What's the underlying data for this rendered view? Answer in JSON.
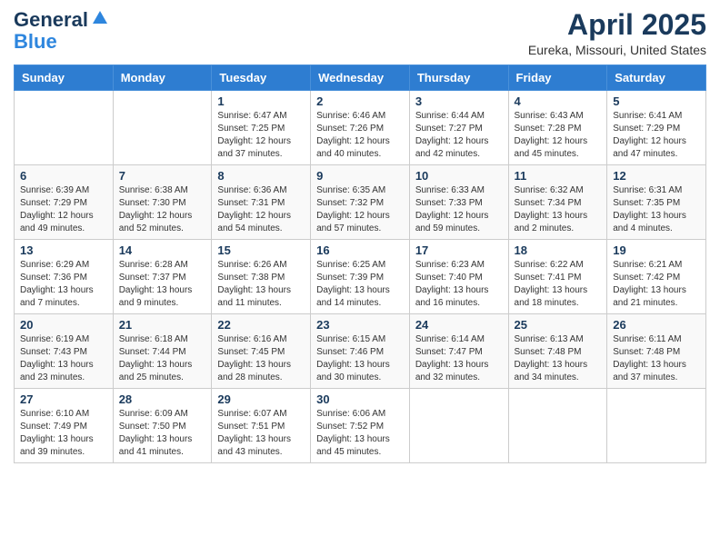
{
  "header": {
    "logo_line1": "General",
    "logo_line2": "Blue",
    "month_title": "April 2025",
    "location": "Eureka, Missouri, United States"
  },
  "days_of_week": [
    "Sunday",
    "Monday",
    "Tuesday",
    "Wednesday",
    "Thursday",
    "Friday",
    "Saturday"
  ],
  "weeks": [
    [
      {
        "day": "",
        "info": ""
      },
      {
        "day": "",
        "info": ""
      },
      {
        "day": "1",
        "info": "Sunrise: 6:47 AM\nSunset: 7:25 PM\nDaylight: 12 hours and 37 minutes."
      },
      {
        "day": "2",
        "info": "Sunrise: 6:46 AM\nSunset: 7:26 PM\nDaylight: 12 hours and 40 minutes."
      },
      {
        "day": "3",
        "info": "Sunrise: 6:44 AM\nSunset: 7:27 PM\nDaylight: 12 hours and 42 minutes."
      },
      {
        "day": "4",
        "info": "Sunrise: 6:43 AM\nSunset: 7:28 PM\nDaylight: 12 hours and 45 minutes."
      },
      {
        "day": "5",
        "info": "Sunrise: 6:41 AM\nSunset: 7:29 PM\nDaylight: 12 hours and 47 minutes."
      }
    ],
    [
      {
        "day": "6",
        "info": "Sunrise: 6:39 AM\nSunset: 7:29 PM\nDaylight: 12 hours and 49 minutes."
      },
      {
        "day": "7",
        "info": "Sunrise: 6:38 AM\nSunset: 7:30 PM\nDaylight: 12 hours and 52 minutes."
      },
      {
        "day": "8",
        "info": "Sunrise: 6:36 AM\nSunset: 7:31 PM\nDaylight: 12 hours and 54 minutes."
      },
      {
        "day": "9",
        "info": "Sunrise: 6:35 AM\nSunset: 7:32 PM\nDaylight: 12 hours and 57 minutes."
      },
      {
        "day": "10",
        "info": "Sunrise: 6:33 AM\nSunset: 7:33 PM\nDaylight: 12 hours and 59 minutes."
      },
      {
        "day": "11",
        "info": "Sunrise: 6:32 AM\nSunset: 7:34 PM\nDaylight: 13 hours and 2 minutes."
      },
      {
        "day": "12",
        "info": "Sunrise: 6:31 AM\nSunset: 7:35 PM\nDaylight: 13 hours and 4 minutes."
      }
    ],
    [
      {
        "day": "13",
        "info": "Sunrise: 6:29 AM\nSunset: 7:36 PM\nDaylight: 13 hours and 7 minutes."
      },
      {
        "day": "14",
        "info": "Sunrise: 6:28 AM\nSunset: 7:37 PM\nDaylight: 13 hours and 9 minutes."
      },
      {
        "day": "15",
        "info": "Sunrise: 6:26 AM\nSunset: 7:38 PM\nDaylight: 13 hours and 11 minutes."
      },
      {
        "day": "16",
        "info": "Sunrise: 6:25 AM\nSunset: 7:39 PM\nDaylight: 13 hours and 14 minutes."
      },
      {
        "day": "17",
        "info": "Sunrise: 6:23 AM\nSunset: 7:40 PM\nDaylight: 13 hours and 16 minutes."
      },
      {
        "day": "18",
        "info": "Sunrise: 6:22 AM\nSunset: 7:41 PM\nDaylight: 13 hours and 18 minutes."
      },
      {
        "day": "19",
        "info": "Sunrise: 6:21 AM\nSunset: 7:42 PM\nDaylight: 13 hours and 21 minutes."
      }
    ],
    [
      {
        "day": "20",
        "info": "Sunrise: 6:19 AM\nSunset: 7:43 PM\nDaylight: 13 hours and 23 minutes."
      },
      {
        "day": "21",
        "info": "Sunrise: 6:18 AM\nSunset: 7:44 PM\nDaylight: 13 hours and 25 minutes."
      },
      {
        "day": "22",
        "info": "Sunrise: 6:16 AM\nSunset: 7:45 PM\nDaylight: 13 hours and 28 minutes."
      },
      {
        "day": "23",
        "info": "Sunrise: 6:15 AM\nSunset: 7:46 PM\nDaylight: 13 hours and 30 minutes."
      },
      {
        "day": "24",
        "info": "Sunrise: 6:14 AM\nSunset: 7:47 PM\nDaylight: 13 hours and 32 minutes."
      },
      {
        "day": "25",
        "info": "Sunrise: 6:13 AM\nSunset: 7:48 PM\nDaylight: 13 hours and 34 minutes."
      },
      {
        "day": "26",
        "info": "Sunrise: 6:11 AM\nSunset: 7:48 PM\nDaylight: 13 hours and 37 minutes."
      }
    ],
    [
      {
        "day": "27",
        "info": "Sunrise: 6:10 AM\nSunset: 7:49 PM\nDaylight: 13 hours and 39 minutes."
      },
      {
        "day": "28",
        "info": "Sunrise: 6:09 AM\nSunset: 7:50 PM\nDaylight: 13 hours and 41 minutes."
      },
      {
        "day": "29",
        "info": "Sunrise: 6:07 AM\nSunset: 7:51 PM\nDaylight: 13 hours and 43 minutes."
      },
      {
        "day": "30",
        "info": "Sunrise: 6:06 AM\nSunset: 7:52 PM\nDaylight: 13 hours and 45 minutes."
      },
      {
        "day": "",
        "info": ""
      },
      {
        "day": "",
        "info": ""
      },
      {
        "day": "",
        "info": ""
      }
    ]
  ]
}
